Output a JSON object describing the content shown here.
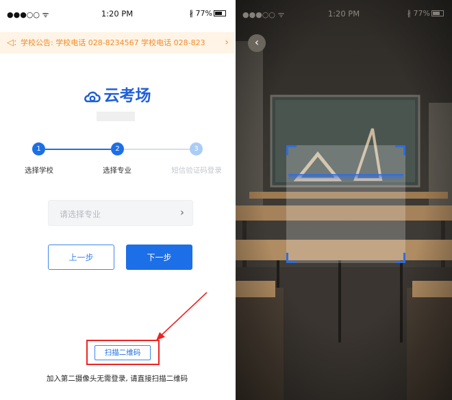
{
  "left_screen": {
    "status_bar": {
      "signal": "●●●○○ ᯤ",
      "time": "1:20 PM",
      "battery": "77%"
    },
    "notice": {
      "text": "学校公告: 学校电话 028-8234567  学校电话 028-823"
    },
    "logo": {
      "text": "云考场"
    },
    "steps": [
      {
        "number": "1",
        "label": "选择学校",
        "state": "done"
      },
      {
        "number": "2",
        "label": "选择专业",
        "state": "current"
      },
      {
        "number": "3",
        "label": "短信验证码登录",
        "state": "pending"
      }
    ],
    "major_select": {
      "placeholder": "请选择专业"
    },
    "buttons": {
      "prev": "上一步",
      "next": "下一步"
    },
    "scan": {
      "button": "扫描二维码",
      "hint": "加入第二摄像头无需登录, 请直接扫描二维码"
    }
  },
  "right_screen": {
    "status_bar": {
      "signal": "●●●○○ ᯤ",
      "time": "1:20 PM",
      "battery": "77%"
    }
  },
  "colors": {
    "brand_blue": "#1c6fe6",
    "notice_text": "#f28b2c",
    "notice_bg": "#fff4e5",
    "step_pending": "#a9cdf6",
    "highlight_red": "#ee2222"
  },
  "icons": {
    "notice": "speaker-icon",
    "logo": "cloud-exam-logo-icon",
    "chevron": "chevron-right-icon",
    "back": "back-arrow-icon"
  }
}
